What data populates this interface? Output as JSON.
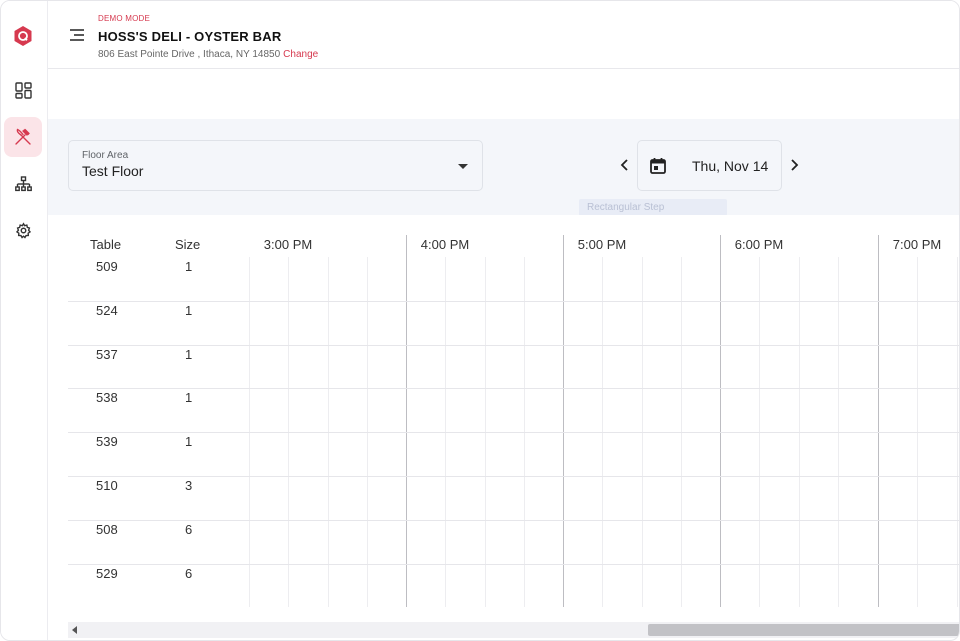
{
  "header": {
    "mode_label": "DEMO MODE",
    "restaurant_name": "HOSS'S DELI - OYSTER BAR",
    "address": "806 East Pointe Drive , Ithaca, NY 14850",
    "change_label": "Change"
  },
  "sidebar": {
    "items": [
      {
        "icon": "logo-icon"
      },
      {
        "icon": "dashboard-icon"
      },
      {
        "icon": "fork-knife-icon",
        "active": true
      },
      {
        "icon": "hierarchy-icon"
      },
      {
        "icon": "gear-icon"
      }
    ]
  },
  "filters": {
    "floor_label": "Floor Area",
    "floor_value": "Test Floor",
    "date": "Thu, Nov 14",
    "ghost_chip": "Rectangular Step"
  },
  "grid": {
    "col_table": "Table",
    "col_size": "Size",
    "hours": [
      "3:00 PM",
      "4:00 PM",
      "5:00 PM",
      "6:00 PM",
      "7:00 PM"
    ],
    "rows": [
      {
        "table": "509",
        "size": "1"
      },
      {
        "table": "524",
        "size": "1"
      },
      {
        "table": "537",
        "size": "1"
      },
      {
        "table": "538",
        "size": "1"
      },
      {
        "table": "539",
        "size": "1"
      },
      {
        "table": "510",
        "size": "3"
      },
      {
        "table": "508",
        "size": "6"
      },
      {
        "table": "529",
        "size": "6"
      }
    ]
  },
  "colors": {
    "accent": "#d6394f",
    "active_bg": "#fbe4e8",
    "band_bg": "#f4f6fa"
  }
}
